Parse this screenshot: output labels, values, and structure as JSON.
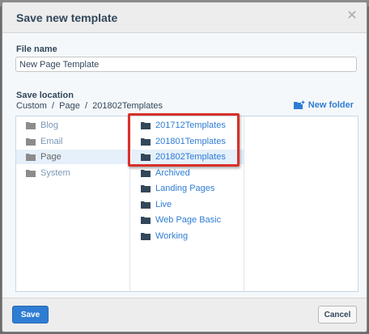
{
  "dialog": {
    "title": "Save new template"
  },
  "file_name": {
    "label": "File name",
    "value": "New Page Template"
  },
  "save_location": {
    "label": "Save location",
    "path": "Custom  /  Page  /  201802Templates",
    "new_folder_label": "New folder"
  },
  "columns": {
    "first": [
      {
        "label": "Blog",
        "selected": false
      },
      {
        "label": "Email",
        "selected": false
      },
      {
        "label": "Page",
        "selected": true
      },
      {
        "label": "System",
        "selected": false
      }
    ],
    "second": [
      {
        "label": "201712Templates",
        "selected": false
      },
      {
        "label": "201801Templates",
        "selected": false
      },
      {
        "label": "201802Templates",
        "selected": true
      },
      {
        "label": "Archived",
        "selected": false
      },
      {
        "label": "Landing Pages",
        "selected": false
      },
      {
        "label": "Live",
        "selected": false
      },
      {
        "label": "Web Page Basic",
        "selected": false
      },
      {
        "label": "Working",
        "selected": false
      }
    ]
  },
  "footer": {
    "save_label": "Save",
    "cancel_label": "Cancel"
  },
  "colors": {
    "accent": "#2f7dd3",
    "highlight": "#d9302a",
    "selected_row": "#e5f0fa"
  }
}
